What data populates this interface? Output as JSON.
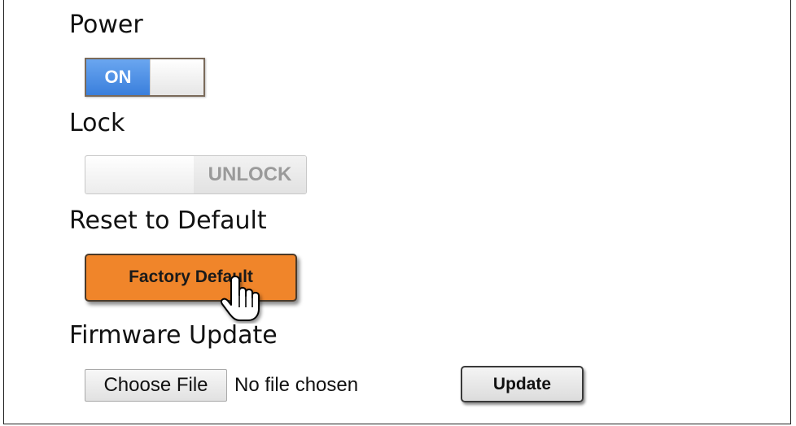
{
  "power": {
    "label": "Power",
    "toggle_text": "ON",
    "state": "on",
    "accent_color": "#3a7fdc"
  },
  "lock": {
    "label": "Lock",
    "toggle_text": "UNLOCK",
    "state": "off"
  },
  "reset": {
    "label": "Reset to Default",
    "button_label": "Factory Default",
    "button_color": "#f0852a",
    "cursor_icon": "hand-pointer-icon"
  },
  "firmware": {
    "label": "Firmware Update",
    "choose_file_label": "Choose File",
    "file_status": "No file chosen",
    "update_label": "Update"
  }
}
